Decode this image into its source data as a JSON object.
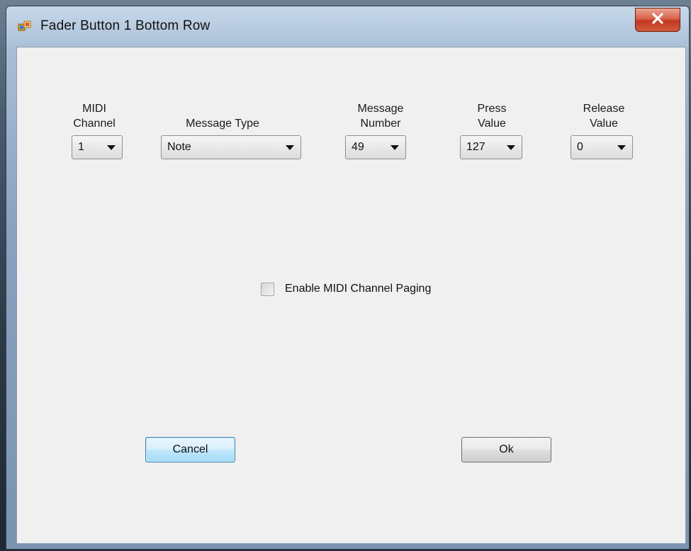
{
  "window": {
    "title": "Fader Button 1 Bottom Row",
    "close_glyph": "✕"
  },
  "fields": {
    "midi_channel": {
      "label_line1": "MIDI",
      "label_line2": "Channel",
      "value": "1"
    },
    "message_type": {
      "label_line1": "Message Type",
      "value": "Note"
    },
    "message_number": {
      "label_line1": "Message",
      "label_line2": "Number",
      "value": "49"
    },
    "press_value": {
      "label_line1": "Press",
      "label_line2": "Value",
      "value": "127"
    },
    "release_value": {
      "label_line1": "Release",
      "label_line2": "Value",
      "value": "0"
    }
  },
  "paging": {
    "label": "Enable MIDI Channel Paging",
    "checked": false
  },
  "buttons": {
    "cancel": "Cancel",
    "ok": "Ok"
  },
  "icons": {
    "app": "app-icon",
    "close": "close-icon",
    "dropdown": "chevron-down-icon"
  },
  "colors": {
    "close_button": "#c0391f",
    "client_background": "#f0f0f0",
    "default_button_border": "#3c7fb1"
  }
}
